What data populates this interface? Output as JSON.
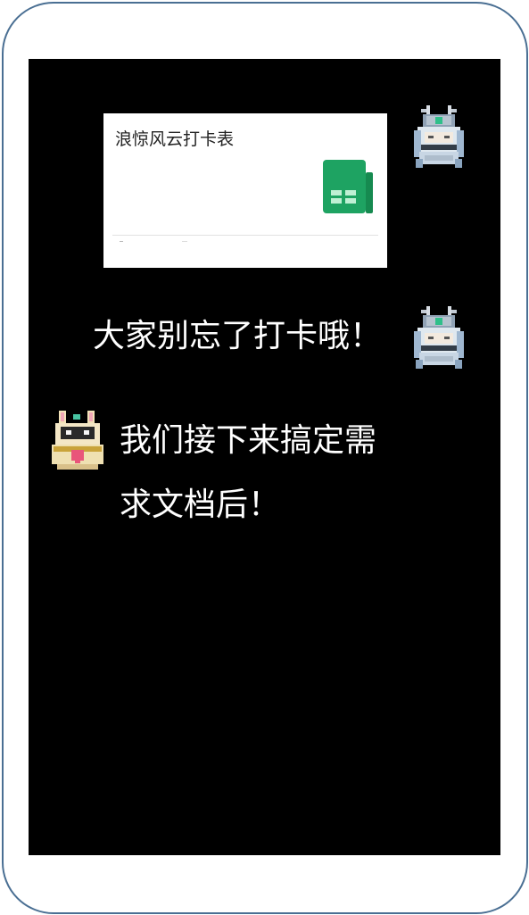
{
  "chat": {
    "card": {
      "title": "浪惊风云打卡表",
      "icon": "google-sheets-icon",
      "accent": "#1ea362"
    },
    "messages": [
      {
        "side": "right",
        "text": "大家别忘了打卡哦！",
        "avatar": "armored-knight-avatar"
      },
      {
        "side": "left",
        "lines": [
          "我们接下来搞定需",
          "求文档后！"
        ],
        "avatar": "bunny-helmet-avatar"
      }
    ]
  },
  "colors": {
    "frame_border": "#4a6f93",
    "screen_bg": "#000000",
    "text": "#ffffff"
  }
}
